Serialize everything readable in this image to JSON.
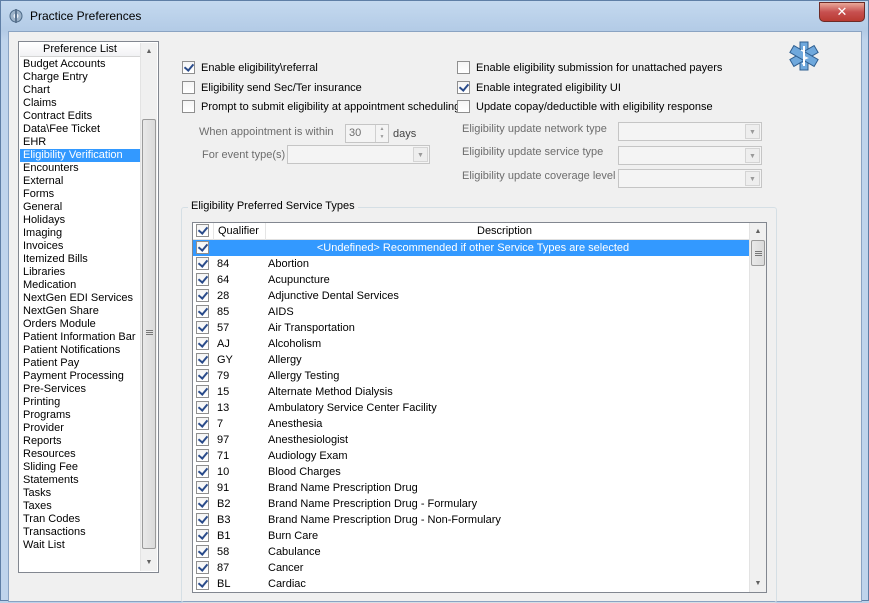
{
  "window": {
    "title": "Practice Preferences",
    "close_glyph": "✕",
    "app_icon": "caduceus-gear-icon",
    "logo_icon": "star-of-life-icon"
  },
  "preference_list": {
    "header": "Preference List",
    "selected": "Eligibility Verification",
    "items": [
      "Budget Accounts",
      "Charge Entry",
      "Chart",
      "Claims",
      "Contract Edits",
      "Data\\Fee Ticket",
      "EHR",
      "Eligibility Verification",
      "Encounters",
      "External",
      "Forms",
      "General",
      "Holidays",
      "Imaging",
      "Invoices",
      "Itemized Bills",
      "Libraries",
      "Medication",
      "NextGen EDI Services",
      "NextGen Share",
      "Orders Module",
      "Patient Information Bar",
      "Patient Notifications",
      "Patient Pay",
      "Payment Processing",
      "Pre-Services",
      "Printing",
      "Programs",
      "Provider",
      "Reports",
      "Resources",
      "Sliding Fee",
      "Statements",
      "Tasks",
      "Taxes",
      "Tran Codes",
      "Transactions",
      "Wait List"
    ]
  },
  "options_left": [
    {
      "label": "Enable eligibility\\referral",
      "checked": true
    },
    {
      "label": "Eligibility send Sec/Ter insurance",
      "checked": false
    },
    {
      "label": "Prompt to submit eligibility at appointment scheduling",
      "checked": false
    }
  ],
  "options_right": [
    {
      "label": "Enable eligibility submission for unattached payers",
      "checked": false
    },
    {
      "label": "Enable integrated eligibility UI",
      "checked": true
    },
    {
      "label": "Update copay/deductible with eligibility response",
      "checked": false
    }
  ],
  "appointment": {
    "label": "When appointment is within",
    "value": "30",
    "unit": "days",
    "event_label": "For event type(s)"
  },
  "update_fields": {
    "network_type_label": "Eligibility update network type",
    "service_type_label": "Eligibility update service type",
    "coverage_level_label": "Eligibility update coverage level"
  },
  "service_types": {
    "group_title": "Eligibility Preferred Service Types",
    "col_qualifier": "Qualifier",
    "col_description": "Description",
    "rows": [
      {
        "q": "",
        "d": "<Undefined> Recommended if other Service Types are selected",
        "checked": true,
        "selected": true
      },
      {
        "q": "84",
        "d": "Abortion",
        "checked": true
      },
      {
        "q": "64",
        "d": "Acupuncture",
        "checked": true
      },
      {
        "q": "28",
        "d": "Adjunctive Dental Services",
        "checked": true
      },
      {
        "q": "85",
        "d": "AIDS",
        "checked": true
      },
      {
        "q": "57",
        "d": "Air Transportation",
        "checked": true
      },
      {
        "q": "AJ",
        "d": "Alcoholism",
        "checked": true
      },
      {
        "q": "GY",
        "d": "Allergy",
        "checked": true
      },
      {
        "q": "79",
        "d": "Allergy Testing",
        "checked": true
      },
      {
        "q": "15",
        "d": "Alternate Method Dialysis",
        "checked": true
      },
      {
        "q": "13",
        "d": "Ambulatory Service Center Facility",
        "checked": true
      },
      {
        "q": "7",
        "d": "Anesthesia",
        "checked": true
      },
      {
        "q": "97",
        "d": "Anesthesiologist",
        "checked": true
      },
      {
        "q": "71",
        "d": "Audiology Exam",
        "checked": true
      },
      {
        "q": "10",
        "d": "Blood Charges",
        "checked": true
      },
      {
        "q": "91",
        "d": "Brand Name Prescription Drug",
        "checked": true
      },
      {
        "q": "B2",
        "d": "Brand Name Prescription Drug - Formulary",
        "checked": true
      },
      {
        "q": "B3",
        "d": "Brand Name Prescription Drug - Non-Formulary",
        "checked": true
      },
      {
        "q": "B1",
        "d": "Burn Care",
        "checked": true
      },
      {
        "q": "58",
        "d": "Cabulance",
        "checked": true
      },
      {
        "q": "87",
        "d": "Cancer",
        "checked": true
      },
      {
        "q": "BL",
        "d": "Cardiac",
        "checked": true
      }
    ]
  }
}
